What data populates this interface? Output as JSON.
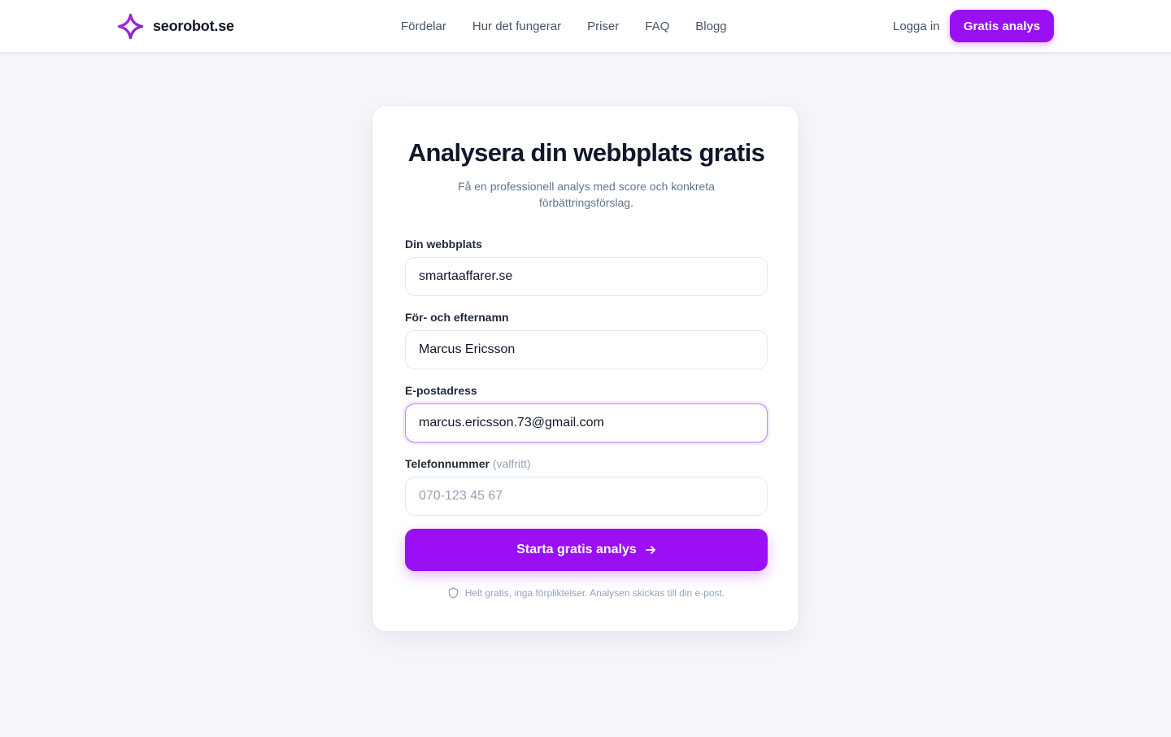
{
  "header": {
    "brand_name": "seorobot.se",
    "nav_links": [
      "Fördelar",
      "Hur det fungerar",
      "Priser",
      "FAQ",
      "Blogg"
    ],
    "login_label": "Logga in",
    "cta_label": "Gratis analys",
    "logo_icon": "sparkle-star-icon"
  },
  "form": {
    "title": "Analysera din webbplats gratis",
    "subtitle": "Få en professionell analys med score och konkreta förbättringsförslag.",
    "fields": {
      "website": {
        "label": "Din webbplats",
        "value": "smartaaffarer.se"
      },
      "name": {
        "label": "För- och efternamn",
        "value": "Marcus Ericsson"
      },
      "email": {
        "label": "E-postadress",
        "value": "marcus.ericsson.73@gmail.com"
      },
      "phone": {
        "label": "Telefonnummer",
        "optional_label": "(valfritt)",
        "placeholder": "070-123 45 67",
        "value": ""
      }
    },
    "submit_label": "Starta gratis analys",
    "disclaimer": "Helt gratis, inga förpliktelser. Analysen skickas till din e-post."
  },
  "colors": {
    "accent": "#9b0ff5",
    "background": "#f5f5fa",
    "text_primary": "#0f172a",
    "text_muted": "#64748b"
  }
}
